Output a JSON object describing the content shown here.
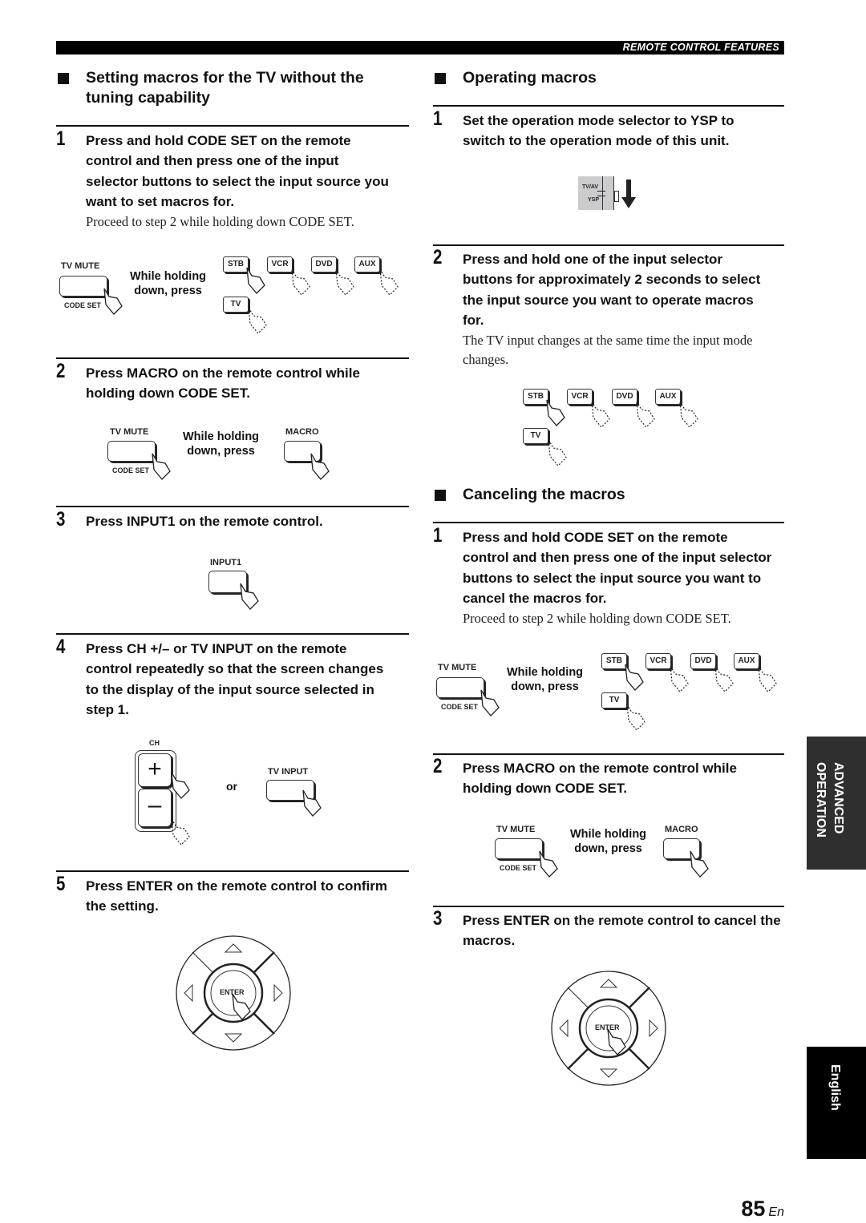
{
  "header": {
    "section_title": "REMOTE CONTROL FEATURES"
  },
  "left": {
    "section_title_line1": "Setting macros for the TV without the",
    "section_title_line2": "tuning capability",
    "steps": [
      {
        "num": "1",
        "text": "Press and hold CODE SET on the remote control and then press one of the input selector buttons to select the input source you want to set macros for.",
        "note": "Proceed to step 2 while holding down CODE SET."
      },
      {
        "num": "2",
        "text": "Press MACRO on the remote control while holding down CODE SET."
      },
      {
        "num": "3",
        "text": "Press INPUT1 on the remote control."
      },
      {
        "num": "4",
        "text": "Press CH +/– or TV INPUT on the remote control repeatedly so that the screen changes to the display of the input source selected in step 1."
      },
      {
        "num": "5",
        "text": "Press ENTER on the remote control to confirm the setting."
      }
    ]
  },
  "right": {
    "operating": {
      "title": "Operating macros",
      "steps": [
        {
          "num": "1",
          "text": "Set the operation mode selector to YSP to switch to the operation mode of this unit."
        },
        {
          "num": "2",
          "text": "Press and hold one of the input selector buttons for approximately 2 seconds to select the input source you want to operate macros for.",
          "note": "The TV input changes at the same time the input mode changes."
        }
      ]
    },
    "canceling": {
      "title": "Canceling the macros",
      "steps": [
        {
          "num": "1",
          "text": "Press and hold CODE SET on the remote control and then press one of the input selector buttons to select the input source you want to cancel the macros for.",
          "note": "Proceed to step 2 while holding down CODE SET."
        },
        {
          "num": "2",
          "text": "Press MACRO on the remote control while holding down CODE SET."
        },
        {
          "num": "3",
          "text": "Press ENTER on the remote control to cancel the macros."
        }
      ]
    }
  },
  "figures": {
    "tv_mute": "TV MUTE",
    "code_set": "CODE SET",
    "while_holding_1": "While holding",
    "while_holding_2": "down, press",
    "selectors": [
      "STB",
      "VCR",
      "DVD",
      "AUX",
      "TV"
    ],
    "macro": "MACRO",
    "input1": "INPUT1",
    "ch": "CH",
    "ch_plus": "+",
    "ch_minus": "–",
    "or": "or",
    "tv_input": "TV INPUT",
    "enter": "ENTER",
    "mode_tvav": "TV/AV",
    "mode_ysp": "YSP"
  },
  "side_tabs": {
    "advanced_line1": "ADVANCED",
    "advanced_line2": "OPERATION",
    "language": "English"
  },
  "footer": {
    "page_number": "85",
    "lang_code": "En"
  }
}
